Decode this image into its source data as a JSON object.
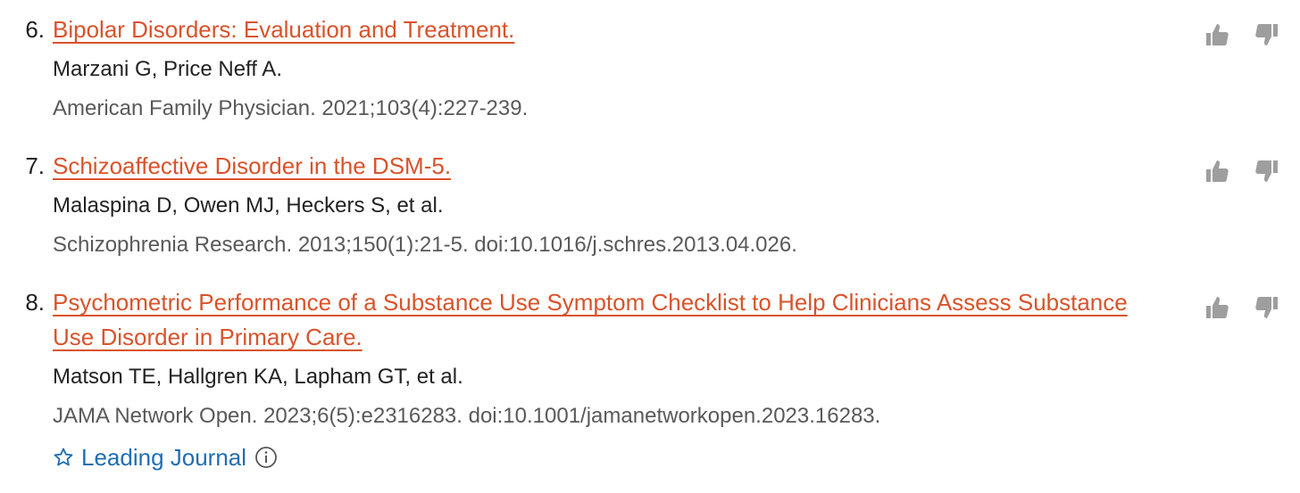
{
  "references": [
    {
      "number": "6.",
      "title": "Bipolar Disorders: Evaluation and Treatment.",
      "authors": "Marzani G, Price Neff A.",
      "source": "American Family Physician. 2021;103(4):227-239."
    },
    {
      "number": "7.",
      "title": "Schizoaffective Disorder in the DSM-5.",
      "authors": "Malaspina D, Owen MJ, Heckers S, et al.",
      "source": "Schizophrenia Research. 2013;150(1):21-5. doi:10.1016/j.schres.2013.04.026."
    },
    {
      "number": "8.",
      "title": "Psychometric Performance of a Substance Use Symptom Checklist to Help Clinicians Assess Substance Use Disorder in Primary Care.",
      "authors": "Matson TE, Hallgren KA, Lapham GT, et al.",
      "source": "JAMA Network Open. 2023;6(5):e2316283. doi:10.1001/jamanetworkopen.2023.16283.",
      "badge": {
        "icon": "star-outline-icon",
        "label": "Leading Journal",
        "info_icon": "info-circle-icon"
      }
    }
  ],
  "vote_icons": {
    "up": "thumbs-up-icon",
    "down": "thumbs-down-icon"
  },
  "colors": {
    "title_link": "#d9532b",
    "authors_text": "#222222",
    "source_text": "#595959",
    "badge_link": "#1f6db3",
    "vote_icon": "#9e9e9e"
  }
}
